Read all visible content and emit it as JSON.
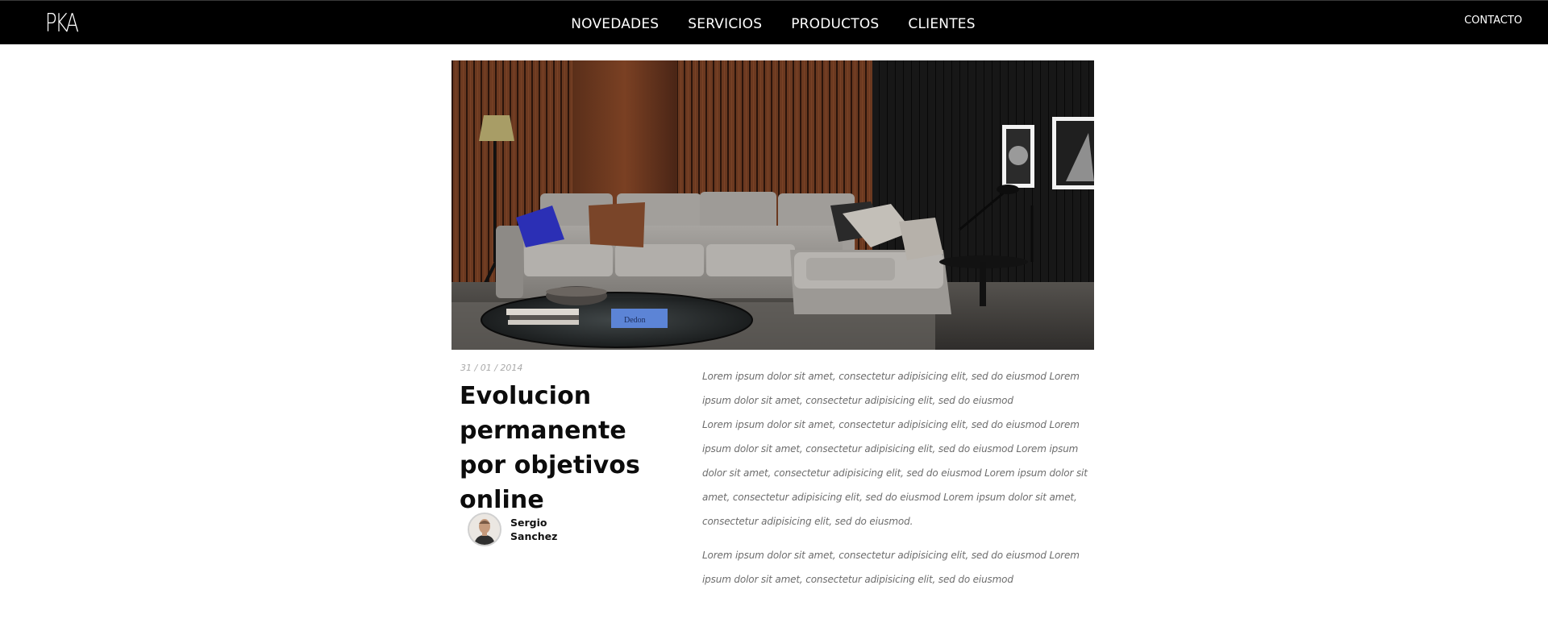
{
  "header": {
    "logo_text": "PKA",
    "nav": [
      {
        "label": "NOVEDADES"
      },
      {
        "label": "SERVICIOS"
      },
      {
        "label": "PRODUCTOS"
      },
      {
        "label": "CLIENTES"
      }
    ],
    "contact_label": "CONTACTO"
  },
  "article": {
    "date": "31 / 01 / 2014",
    "title": "Evolucion permanente por objetivos online",
    "author": {
      "name_line1": "Sergio",
      "name_line2": "Sanchez"
    },
    "paragraphs": [
      "Lorem ipsum dolor sit amet, consectetur adipisicing elit, sed do eiusmod Lorem ipsum dolor sit amet, consectetur adipisicing elit, sed do eiusmod",
      "Lorem ipsum dolor sit amet, consectetur adipisicing elit, sed do eiusmod Lorem ipsum dolor sit amet, consectetur adipisicing elit, sed do eiusmod Lorem ipsum dolor sit amet, consectetur adipisicing elit, sed do eiusmod Lorem ipsum dolor sit amet, consectetur adipisicing elit, sed do eiusmod Lorem ipsum dolor sit amet, consectetur adipisicing elit, sed do eiusmod.",
      "Lorem ipsum dolor sit amet, consectetur adipisicing elit, sed do eiusmod Lorem ipsum dolor sit amet, consectetur adipisicing elit, sed do eiusmod"
    ]
  },
  "hero_image": {
    "subject": "living-room-sofa-photo",
    "book_text": "Dedon"
  },
  "colors": {
    "header_bg": "#000000",
    "header_text": "#ffffff",
    "title_text": "#0c0c0c",
    "body_text": "#6d6d6d",
    "date_text": "#a9a9a9"
  }
}
